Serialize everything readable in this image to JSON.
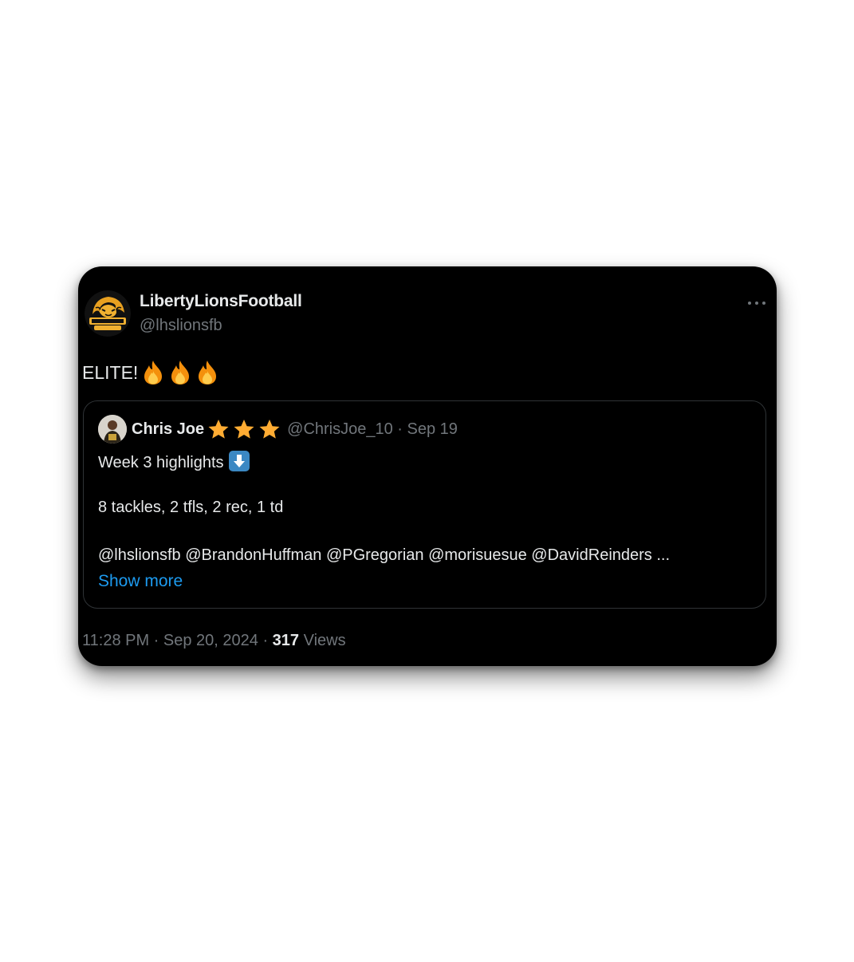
{
  "tweet": {
    "display_name": "LibertyLionsFootball",
    "handle": "@lhslionsfb",
    "avatar_icon": "lion-logo-avatar",
    "more_icon": "more-options-icon",
    "text": "ELITE!",
    "emojis": [
      "fire-icon",
      "fire-icon",
      "fire-icon"
    ],
    "timestamp": "11:28 PM · Sep 20, 2024 · ",
    "views_count": "317",
    "views_label": " Views"
  },
  "quote": {
    "display_name": "Chris Joe",
    "name_emojis": [
      "star-icon",
      "star-icon",
      "star-icon"
    ],
    "handle_date": "@ChrisJoe_10 · Sep 19",
    "line1": "Week 3 highlights",
    "line1_emoji": "down-arrow-icon",
    "line2": "8 tackles, 2 tfls, 2 rec, 1 td",
    "line3": "@lhslionsfb @BrandonHuffman @PGregorian @morisuesue @DavidReinders ...",
    "show_more": "Show more"
  },
  "colors": {
    "background": "#000000",
    "text": "#e7e9ea",
    "secondary": "#71767b",
    "link": "#1d9bf0",
    "border": "#2f3336"
  }
}
